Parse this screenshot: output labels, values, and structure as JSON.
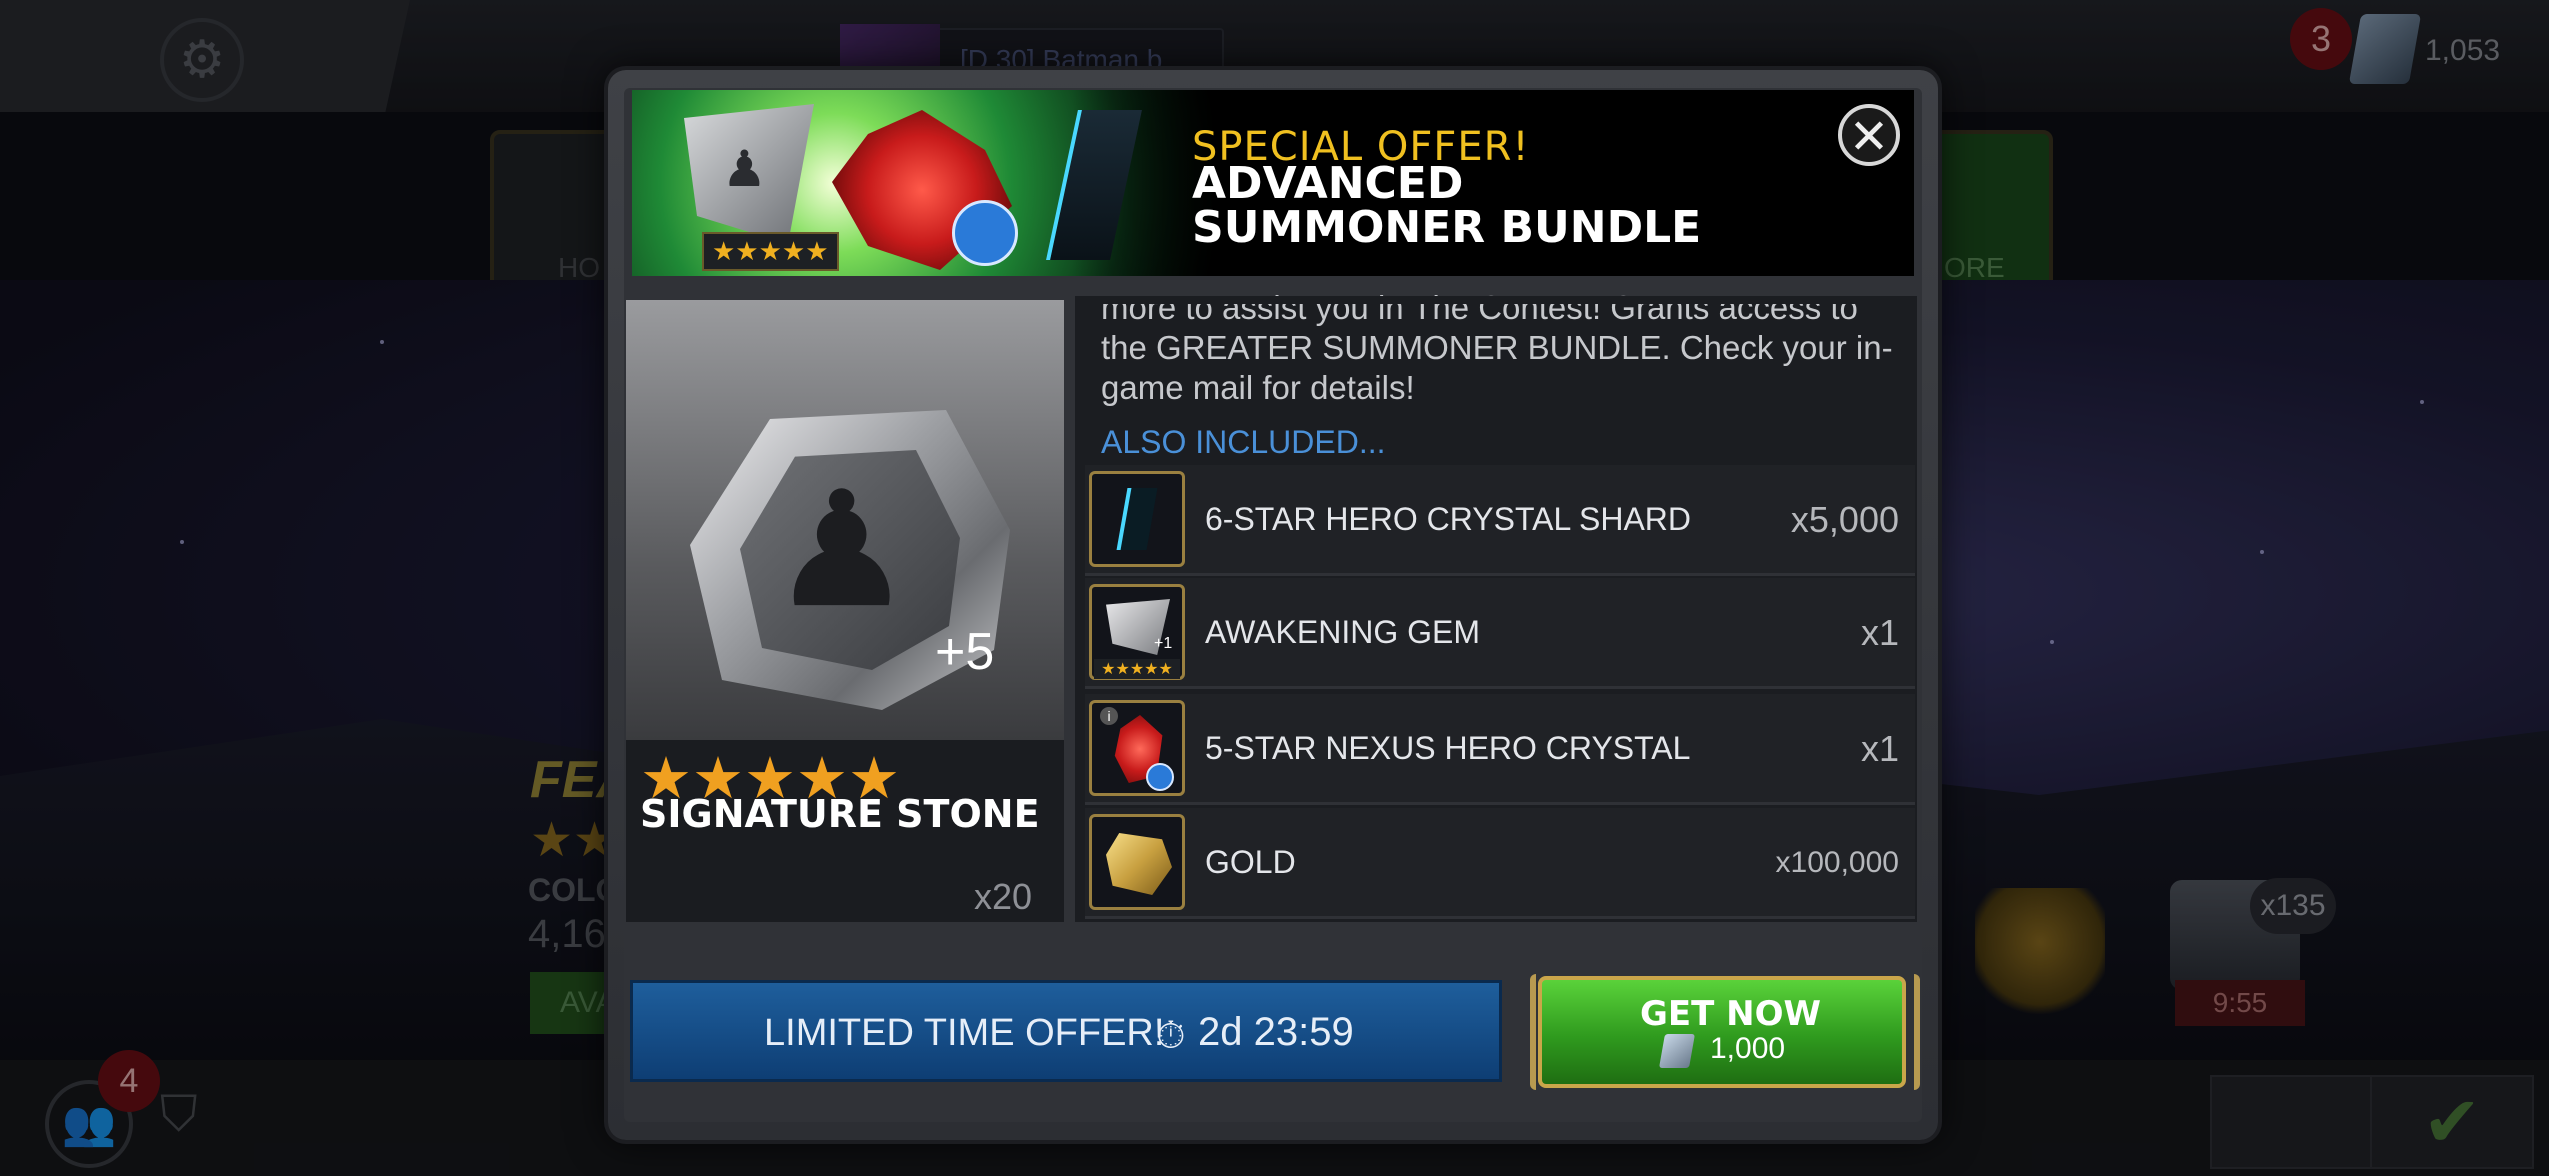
{
  "background": {
    "player_name": "[D.30] Batman b",
    "notification_count": "3",
    "units_balance": "1,053",
    "nav_left_label": "HO",
    "nav_right_label": "ORE",
    "featured": {
      "title": "FEA",
      "stars": "★★",
      "collection_label": "COLO",
      "number": "4,16",
      "button_label": "AVA"
    },
    "chest_count": "x135",
    "chest_timer": "9:55",
    "alliance_count": "4"
  },
  "modal": {
    "kicker": "SPECIAL OFFER!",
    "title": "ADVANCED SUMMONER BUNDLE",
    "banner_stars": "★★★★★",
    "close_label": "✕",
    "featured_item": {
      "stars": "★★★★★",
      "name": "SIGNATURE STONE",
      "plus_value": "+5",
      "quantity": "x20",
      "glyph": "♟"
    },
    "description": "more to assist you in The Contest! Grants access to the GREATER SUMMONER BUNDLE. Check your in-game mail for details!",
    "also_included_label": "ALSO INCLUDED...",
    "items": [
      {
        "name": "6-STAR HERO CRYSTAL SHARD",
        "quantity": "x5,000",
        "icon": "crystal-shard-icon"
      },
      {
        "name": "AWAKENING GEM",
        "quantity": "x1",
        "icon": "awakening-gem-icon",
        "icon_stars": "★★★★★",
        "icon_badge": "+1"
      },
      {
        "name": "5-STAR NEXUS HERO CRYSTAL",
        "quantity": "x1",
        "icon": "nexus-crystal-icon",
        "info": "i"
      },
      {
        "name": "GOLD",
        "quantity": "x100,000",
        "icon": "gold-icon"
      }
    ],
    "offer_label": "LIMITED TIME OFFER!",
    "timer_icon": "⏱",
    "timer_value": "2d 23:59",
    "buy_label": "GET NOW",
    "buy_price": "1,000"
  }
}
